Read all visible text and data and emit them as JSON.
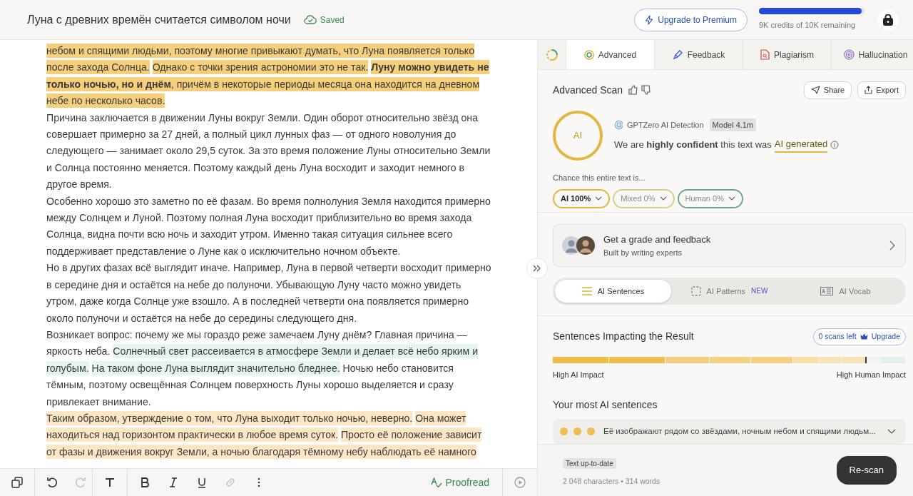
{
  "document": {
    "title": "Луна с древних времён считается символом ночи",
    "save_status": "Saved",
    "paragraphs": [
      [
        {
          "text": "небом и спящими людьми, поэтому многие привыкают думать, что Луна появляется только после захода Солнца.",
          "color": "#f6cf7c"
        },
        {
          "text": "Однако с точки зрения астрономии это не так.",
          "color": "#f6cf7c"
        },
        {
          "text": "**Луну можно увидеть не только ночью, но и днём**, причём в некоторые периоды месяца она находится на дневном небе по несколько часов.",
          "color": "#f6cf7c"
        }
      ],
      [
        {
          "text": "Причина заключается в движении Луны вокруг Земли. Один оборот относительно звёзд она совершает примерно за 27 дней, а полный цикл лунных фаз — от одного новолуния до следующего — занимает около 29,5 суток. За это время положение Луны относительно Земли и Солнца постоянно меняется. Поэтому каждый день Луна восходит и заходит немного в другое время."
        }
      ],
      [
        {
          "text": "Особенно хорошо это заметно по её фазам. Во время полнолуния Земля находится примерно между Солнцем и Луной. Поэтому полная Луна восходит приблизительно во время захода Солнца, видна почти всю ночь и заходит утром. Именно такая ситуация сильнее всего поддерживает представление о Луне как о исключительно ночном объекте."
        }
      ],
      [
        {
          "text": "Но в других фазах всё выглядит иначе. Например, Луна в первой четверти восходит примерно в середине дня и остаётся на небе до полуночи. Убывающую Луну часто можно увидеть утром, даже когда Солнце уже взошло. А в последней четверти она появляется примерно около полуночи и остаётся на небе до середины следующего дня."
        }
      ],
      [
        {
          "text": "Возникает вопрос: почему же мы гораздо реже замечаем Луну днём? Главная причина — яркость неба."
        },
        {
          "text": "Солнечный свет рассеивается в атмосфере Земли и делает всё небо ярким и голубым.",
          "color": "#e6f4ee"
        },
        {
          "text": "На таком фоне Луна выглядит значительно бледнее.",
          "color": "#e6f4ee"
        },
        {
          "text": "Ночью небо становится тёмным, поэтому освещённая Солнцем поверхность Луны хорошо выделяется и сразу привлекает внимание."
        }
      ],
      [
        {
          "text": "Таким образом, утверждение о том, что Луна выходит только ночью, неверно.",
          "color": "#fde6c4"
        },
        {
          "text": "Она может находиться над горизонтом практически в любое время суток.",
          "color": "#fde6c4"
        },
        {
          "text": "Просто её положение зависит от фазы и движения вокруг Земли, а ночью благодаря тёмному небу наблюдать её намного",
          "color": "#fde6c4"
        }
      ]
    ]
  },
  "header": {
    "upgrade_button": "Upgrade to Premium",
    "credits": {
      "level": 0.97,
      "text": "9K credits of 10K remaining"
    }
  },
  "toolbar": {
    "items": [
      {
        "kind": "copy",
        "disabled": false
      },
      {
        "kind": "undo",
        "disabled": false
      },
      {
        "kind": "redo",
        "disabled": true
      },
      {
        "kind": "text",
        "disabled": false
      },
      {
        "kind": "bold",
        "disabled": false
      },
      {
        "kind": "italic",
        "disabled": false
      },
      {
        "kind": "underline",
        "disabled": false
      },
      {
        "kind": "link",
        "disabled": true
      },
      {
        "kind": "more",
        "disabled": false
      }
    ],
    "proofread": "Proofread"
  },
  "tabs": [
    {
      "kind": "status",
      "selected": false
    },
    {
      "kind": "advanced",
      "label": "Advanced",
      "selected": true
    },
    {
      "kind": "feedback",
      "label": "Feedback",
      "selected": false
    },
    {
      "kind": "plagiarism",
      "label": "Plagiarism",
      "selected": false
    },
    {
      "kind": "hallucination",
      "label": "Hallucination",
      "selected": false
    }
  ],
  "scan": {
    "title": "Advanced Scan",
    "share": "Share",
    "export": "Export",
    "result_badge": "AI",
    "detector": "GPTZero AI Detection",
    "model": "Model 4.1m",
    "verdict": "We are **highly confident** this text was",
    "verdict_result": "AI generated",
    "chance_label": "Chance this entire text is...",
    "chances": [
      {
        "label": "AI 100%",
        "color": "#e2b740",
        "selected": true
      },
      {
        "label": "Mixed 0%",
        "color": "#d8cf86",
        "selected": false
      },
      {
        "label": "Human 0%",
        "color": "#6aa88a",
        "selected": false
      }
    ]
  },
  "feedback_card": {
    "title": "Get a grade and feedback",
    "subtitle": "Built by writing experts"
  },
  "views": [
    {
      "kind": "sentences",
      "label": "AI Sentences",
      "selected": true
    },
    {
      "kind": "patterns",
      "label": "AI Patterns",
      "badge": "NEW",
      "selected": false
    },
    {
      "kind": "vocab",
      "label": "AI Vocab",
      "selected": false
    }
  ],
  "impact": {
    "title": "Sentences Impacting the Result",
    "scans_left": "0 scans left",
    "upgrade": "Upgrade",
    "left_label": "High AI Impact",
    "right_label": "High Human Impact"
  },
  "most_ai": {
    "title": "Your most AI sentences",
    "items": [
      {
        "text": "Её изображают рядом со звёздами, ночным небом и спящими людьм...",
        "color": "#f0bd55"
      }
    ]
  },
  "footer": {
    "status": "Text up-to-date",
    "stats": "2 048 characters • 314 words",
    "rescan": "Re-scan"
  }
}
